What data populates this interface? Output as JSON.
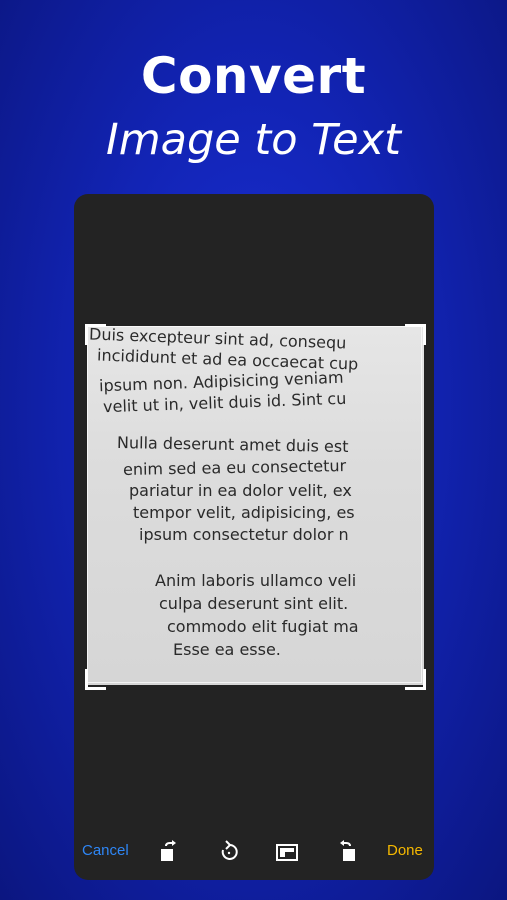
{
  "headline": {
    "title": "Convert",
    "subtitle": "Image to Text"
  },
  "document_lines": [
    "Duis excepteur sint ad, consequ",
    "incididunt et ad ea occaecat cup",
    "ipsum non. Adipisicing veniam",
    "velit ut in, velit duis id. Sint cu",
    "Nulla deserunt amet duis est",
    "enim sed ea eu consectetur",
    "pariatur in ea dolor velit, ex",
    "tempor velit, adipisicing, es",
    "ipsum consectetur dolor n",
    "Anim laboris ullamco veli",
    "culpa deserunt sint elit.",
    "commodo elit fugiat ma",
    "Esse ea esse."
  ],
  "toolbar": {
    "cancel_label": "Cancel",
    "done_label": "Done",
    "cancel_color": "#2e86f5",
    "done_color": "#f5b800",
    "icons": [
      "rotate-left-aspect-icon",
      "rotate-ccw-icon",
      "aspect-ratio-icon",
      "rotate-right-aspect-icon"
    ]
  },
  "colors": {
    "background": "#1224b5",
    "panel": "#232323"
  }
}
